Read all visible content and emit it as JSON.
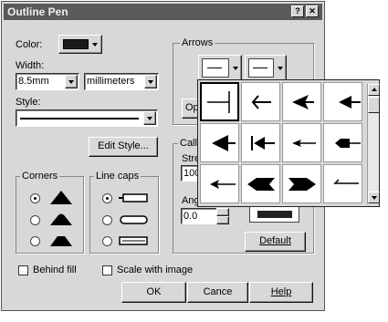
{
  "window": {
    "title": "Outline Pen",
    "help_btn": "?",
    "close_btn": "✕"
  },
  "color": {
    "label": "Color:",
    "swatch": "#1a1a1a"
  },
  "width": {
    "label": "Width:",
    "value": "8.5mm",
    "units": "millimeters"
  },
  "style": {
    "label": "Style:",
    "edit_button": "Edit Style..."
  },
  "corners": {
    "title": "Corners"
  },
  "line_caps": {
    "title": "Line caps"
  },
  "arrows": {
    "title": "Arrows",
    "options_partial": "Opt"
  },
  "calligraphy": {
    "title": "Calli",
    "stretch_partial": "Stre",
    "stretch_value": "100",
    "angle_partial": "Ang",
    "angle_value": "0.0",
    "default_button": "Default"
  },
  "checkboxes": {
    "behind_fill": "Behind fill",
    "scale_with_image": "Scale with image"
  },
  "footer": {
    "ok": "OK",
    "cancel": "Cance",
    "help": "Help"
  },
  "arrow_picker": {
    "cells": [
      "none",
      "open-left-arrow",
      "filled-left-arrow",
      "filled-left-arrow-small",
      "filled-triangle-left",
      "bar-arrow-left",
      "thin-left-arrow",
      "square-end-left",
      "line-arrow-left",
      "feather-left",
      "feather-right",
      "hook-left"
    ]
  }
}
